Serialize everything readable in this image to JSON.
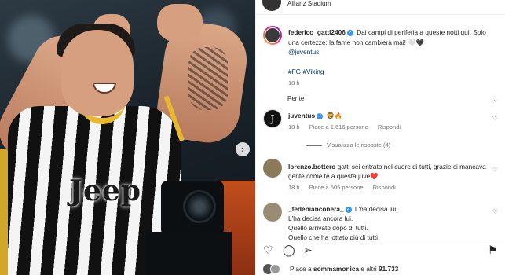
{
  "media": {
    "jersey_text": "Jeep",
    "next_icon": "chevron-right-icon"
  },
  "header": {
    "location": "Allianz Stadium"
  },
  "post": {
    "username": "federico_gatti2406",
    "text": "Dai campi di periferia a queste notti qui. Solo una certezze: la fame non cambierà mai! 🤍🖤",
    "mention": "@juventus",
    "hashtags": "#FG #Viking",
    "time": "18 h",
    "see_less": "Per te"
  },
  "comments": [
    {
      "username": "juventus",
      "text": "🦁🔥",
      "time": "18 h",
      "likes": "Piace a 1.616 persone",
      "reply": "Rispondi",
      "view_replies": "Visualizza le risposte (4)",
      "avatar_color": "#111111"
    },
    {
      "username": "lorenzo.bottero",
      "text": "gatti sei entrato nel cuore di tutti, grazie ci mancava gente come te a questa juve❤️",
      "time": "18 h",
      "likes": "Piace a 505 persone",
      "reply": "Rispondi",
      "avatar_color": "#8a7a5a"
    },
    {
      "username": "_fedebianconera_",
      "text": "L'ha decisa lui.",
      "line2": "L'ha decisa ancora lui.",
      "line3": "Quello arrivato dopo di tutti.",
      "line4": "Quello che ha lottato più di tutti",
      "avatar_color": "#9a8c74"
    }
  ],
  "footer": {
    "like_icon": "heart-icon",
    "comment_icon": "comment-icon",
    "share_icon": "send-icon",
    "save_icon": "bookmark-icon",
    "likes_prefix": "Piace a ",
    "likes_user": "sommamonica",
    "likes_suffix": " e altri ",
    "likes_count": "91.733"
  },
  "colors": {
    "verified": "#3897f0",
    "link": "#00376b",
    "muted": "#737373"
  }
}
